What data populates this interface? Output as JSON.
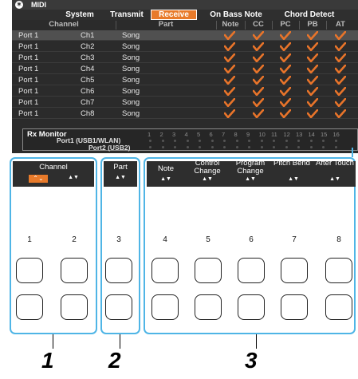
{
  "window": {
    "title": "MIDI",
    "logo_icon": "yamaha-logo-icon"
  },
  "tabs": [
    "System",
    "Transmit",
    "Receive",
    "On Bass Note",
    "Chord Detect"
  ],
  "active_tab": "Receive",
  "columns": {
    "channel": "Channel",
    "part": "Part",
    "note": "Note",
    "cc": "CC",
    "pc": "PC",
    "pb": "PB",
    "at": "AT"
  },
  "rows": [
    {
      "port": "Port 1",
      "ch": "Ch1",
      "part": "Song"
    },
    {
      "port": "Port 1",
      "ch": "Ch2",
      "part": "Song"
    },
    {
      "port": "Port 1",
      "ch": "Ch3",
      "part": "Song"
    },
    {
      "port": "Port 1",
      "ch": "Ch4",
      "part": "Song"
    },
    {
      "port": "Port 1",
      "ch": "Ch5",
      "part": "Song"
    },
    {
      "port": "Port 1",
      "ch": "Ch6",
      "part": "Song"
    },
    {
      "port": "Port 1",
      "ch": "Ch7",
      "part": "Song"
    },
    {
      "port": "Port 1",
      "ch": "Ch8",
      "part": "Song"
    }
  ],
  "check_color": "#e8742a",
  "rx_monitor": {
    "title": "Rx Monitor",
    "channels": [
      "1",
      "2",
      "3",
      "4",
      "5",
      "6",
      "7",
      "8",
      "9",
      "10",
      "11",
      "12",
      "13",
      "14",
      "15",
      "16"
    ],
    "port1": "Port1 (USB1/WLAN)",
    "port2": "Port2 (USB2)"
  },
  "controls": {
    "channel": "Channel",
    "part": "Part",
    "note": "Note",
    "control_change": "Control Change",
    "program_change": "Program Change",
    "pitch_bend": "Pitch Bend",
    "after_touch": "After Touch",
    "arrows": "▲▼",
    "channel_arrows": "⌃⌄"
  },
  "key_numbers": [
    "1",
    "2",
    "3",
    "4",
    "5",
    "6",
    "7",
    "8"
  ],
  "callouts": [
    "1",
    "2",
    "3"
  ],
  "callout_color": "#4fb5e6"
}
